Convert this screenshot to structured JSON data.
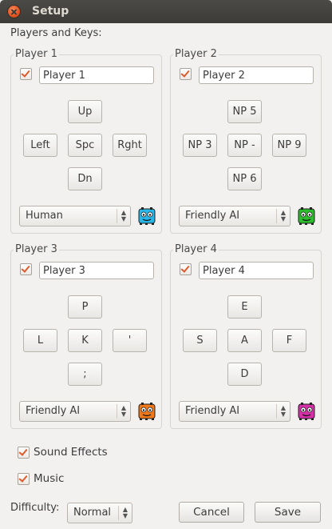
{
  "window": {
    "title": "Setup"
  },
  "section_label": "Players and Keys:",
  "players": [
    {
      "legend": "Player 1",
      "enabled": true,
      "name": "Player 1",
      "keys": {
        "up": "Up",
        "left": "Left",
        "center": "Spc",
        "right": "Rght",
        "down": "Dn"
      },
      "control": "Human",
      "avatar_color": "#28b6e8",
      "avatar_icon": "creature-icon"
    },
    {
      "legend": "Player 2",
      "enabled": true,
      "name": "Player 2",
      "keys": {
        "up": "NP 5",
        "left": "NP 3",
        "center": "NP -",
        "right": "NP 9",
        "down": "NP 6"
      },
      "control": "Friendly AI",
      "avatar_color": "#2cbd2c",
      "avatar_icon": "creature-icon"
    },
    {
      "legend": "Player 3",
      "enabled": true,
      "name": "Player 3",
      "keys": {
        "up": "P",
        "left": "L",
        "center": "K",
        "right": "'",
        "down": ";"
      },
      "control": "Friendly AI",
      "avatar_color": "#f07818",
      "avatar_icon": "creature-icon"
    },
    {
      "legend": "Player 4",
      "enabled": true,
      "name": "Player 4",
      "keys": {
        "up": "E",
        "left": "S",
        "center": "A",
        "right": "F",
        "down": "D"
      },
      "control": "Friendly AI",
      "avatar_color": "#d62fa8",
      "avatar_icon": "creature-icon"
    }
  ],
  "options": {
    "sound_effects": "Sound Effects",
    "music": "Music"
  },
  "difficulty": {
    "label": "Difficulty:",
    "value": "Normal"
  },
  "buttons": {
    "cancel": "Cancel",
    "save": "Save"
  },
  "colors": {
    "accent": "#e05a2a",
    "titlebar": "#3c3b37",
    "background": "#f2f1f0"
  }
}
